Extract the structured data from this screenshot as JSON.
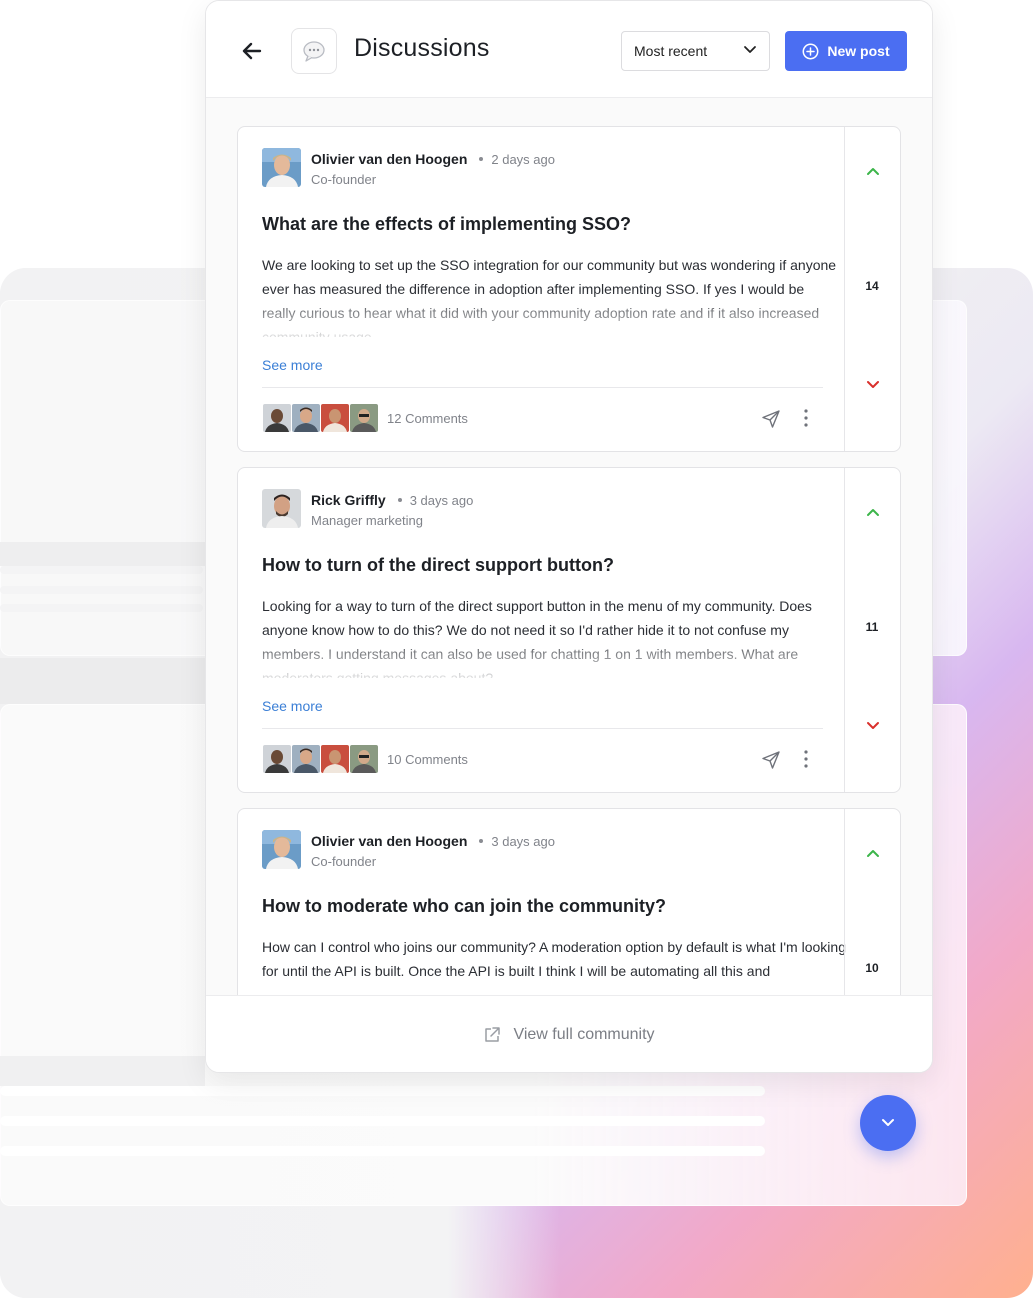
{
  "header": {
    "title": "Discussions",
    "sort_value": "Most recent",
    "new_post_label": "New post"
  },
  "posts": [
    {
      "author": "Olivier van den Hoogen",
      "time": "2 days ago",
      "role": "Co-founder",
      "title": "What are the effects of implementing SSO?",
      "body": "We are looking to set up the SSO integration for our community but was wondering if anyone ever has measured the difference in adoption after implementing SSO. If yes I would be really curious to hear what it did with your community adoption rate and if it also increased community usage.",
      "see_more": "See more",
      "comments": "12 Comments",
      "votes": "14"
    },
    {
      "author": "Rick Griffly",
      "time": "3 days ago",
      "role": "Manager marketing",
      "title": "How to turn of the direct support button?",
      "body": "Looking for a way to turn of the direct support button in the menu of my community. Does anyone know how to do this? We do not need it so I'd rather hide it to not confuse my members. I understand it can also be used for chatting 1 on 1 with members. What are moderators getting messages about?",
      "see_more": "See more",
      "comments": "10 Comments",
      "votes": "11"
    },
    {
      "author": "Olivier van den Hoogen",
      "time": "3 days ago",
      "role": "Co-founder",
      "title": "How to moderate who can join the community?",
      "body": "How can I control who joins our community? A moderation option by default is what I'm looking for until the API is built. Once the API is built I think I will be automating all this and",
      "votes": "10"
    }
  ],
  "footer": {
    "label": "View full community"
  },
  "colors": {
    "accent": "#4b6ef2",
    "upvote": "#3cb54a",
    "downvote": "#d9302c",
    "link": "#3b7fd6"
  },
  "icons": {
    "back": "arrow-left-icon",
    "chat": "chat-bubble-icon",
    "sort": "chevron-down-icon",
    "new_post": "plus-circle-icon",
    "share": "send-icon",
    "more": "more-vertical-icon",
    "up": "chevron-up-icon",
    "down": "chevron-down-icon",
    "external": "external-link-icon",
    "scroll": "chevron-down-icon"
  }
}
